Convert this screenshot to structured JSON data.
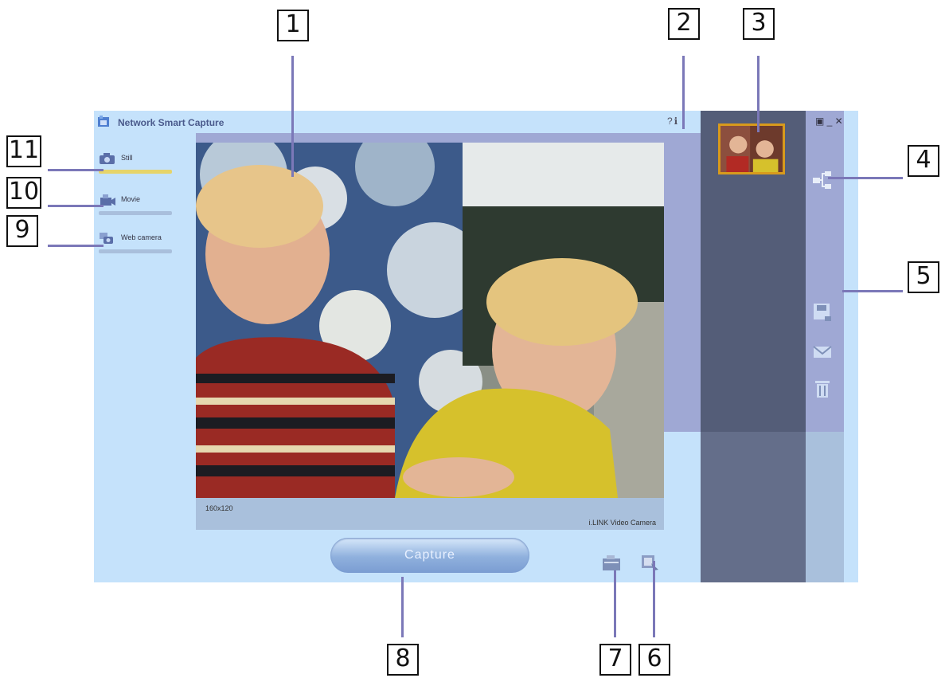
{
  "window": {
    "title": "Network Smart Capture",
    "help_icons": "?ℹ",
    "controls": "▣ _ ✕"
  },
  "modes": [
    {
      "label": "Still",
      "icon": "camera-icon",
      "active": true
    },
    {
      "label": "Movie",
      "icon": "movie-icon",
      "active": false
    },
    {
      "label": "Web camera",
      "icon": "web-camera-icon",
      "active": false
    }
  ],
  "preview": {
    "resolution": "160x120",
    "camera_name": "i.LINK Video Camera"
  },
  "capture_button": "Capture",
  "callouts": [
    "1",
    "2",
    "3",
    "4",
    "5",
    "6",
    "7",
    "8",
    "9",
    "10",
    "11"
  ],
  "colors": {
    "accent": "#7b78b8",
    "panel_light": "#c5e2fb",
    "panel_mid": "#9fa8d4",
    "panel_dark": "#545d78",
    "thumbnail_border": "#d89a1c"
  }
}
